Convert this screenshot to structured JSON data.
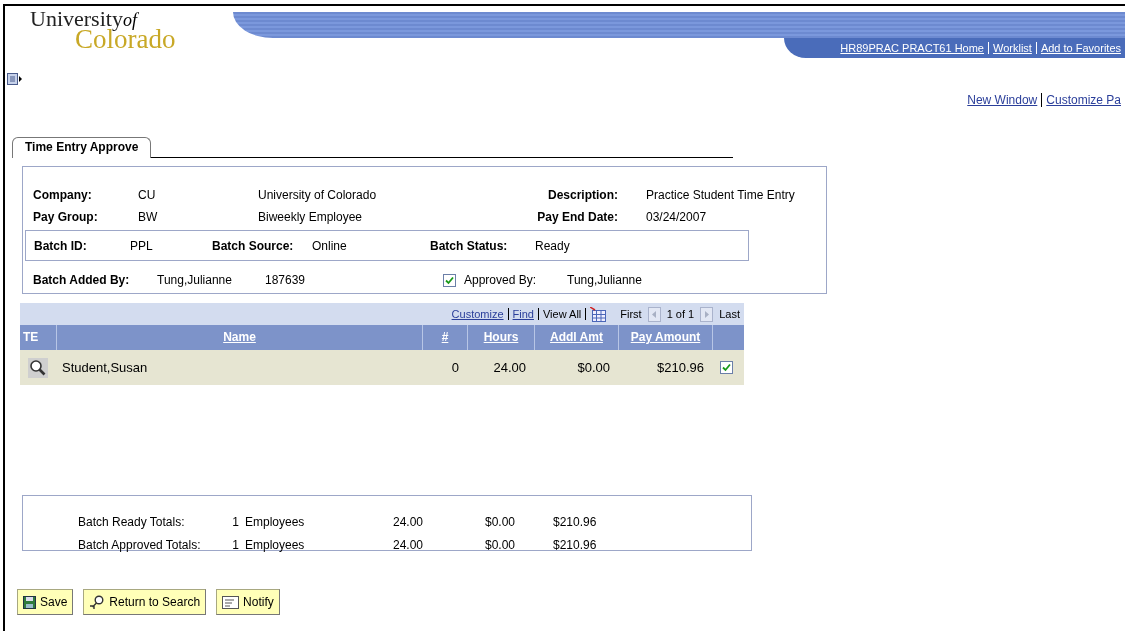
{
  "logo": {
    "word1": "University",
    "small": "of",
    "word2": "Colorado"
  },
  "nav_links": [
    "HR89PRAC PRACT61 Home",
    "Worklist",
    "Add to Favorites"
  ],
  "page_links": [
    "New Window",
    "Customize Pa"
  ],
  "tabs": [
    {
      "label": "Time Entry Approve",
      "selected": true
    }
  ],
  "summary": {
    "rows": [
      {
        "label": "Company:",
        "code": "CU",
        "name": "University of Colorado",
        "label2": "Description:",
        "value2": "Practice Student Time Entry"
      },
      {
        "label": "Pay Group:",
        "code": "BW",
        "name": "Biweekly Employee",
        "label2": "Pay End Date:",
        "value2": "03/24/2007"
      }
    ],
    "batch": [
      {
        "label": "Batch ID:",
        "value": "PPL"
      },
      {
        "label": "Batch Source:",
        "value": "Online"
      },
      {
        "label": "Batch Status:",
        "value": "Ready"
      }
    ],
    "added_by": {
      "label": "Batch Added By:",
      "name": "Tung,Julianne",
      "id": "187639"
    },
    "approved": {
      "checked": true,
      "label": "Approved By:",
      "name": "Tung,Julianne"
    }
  },
  "grid": {
    "toolbar": {
      "links": [
        "Customize",
        "Find"
      ],
      "view_all": "View All",
      "first": "First",
      "count": "1 of 1",
      "last": "Last"
    },
    "columns": [
      "TE",
      "Name",
      "#",
      "Hours",
      "Addl Amt",
      "Pay Amount"
    ],
    "rows": [
      {
        "name": "Student,Susan",
        "number": "0",
        "hours": "24.00",
        "addl": "$0.00",
        "pay": "$210.96",
        "approved": true
      }
    ]
  },
  "totals": [
    {
      "label": "Batch Ready Totals:",
      "count": "1",
      "unit": "Employees",
      "hours": "24.00",
      "addl": "$0.00",
      "pay": "$210.96"
    },
    {
      "label": "Batch Approved Totals:",
      "count": "1",
      "unit": "Employees",
      "hours": "24.00",
      "addl": "$0.00",
      "pay": "$210.96"
    }
  ],
  "buttons": [
    {
      "kind": "save",
      "label": "Save"
    },
    {
      "kind": "search",
      "label": "Return to Search"
    },
    {
      "kind": "notify",
      "label": "Notify"
    }
  ]
}
